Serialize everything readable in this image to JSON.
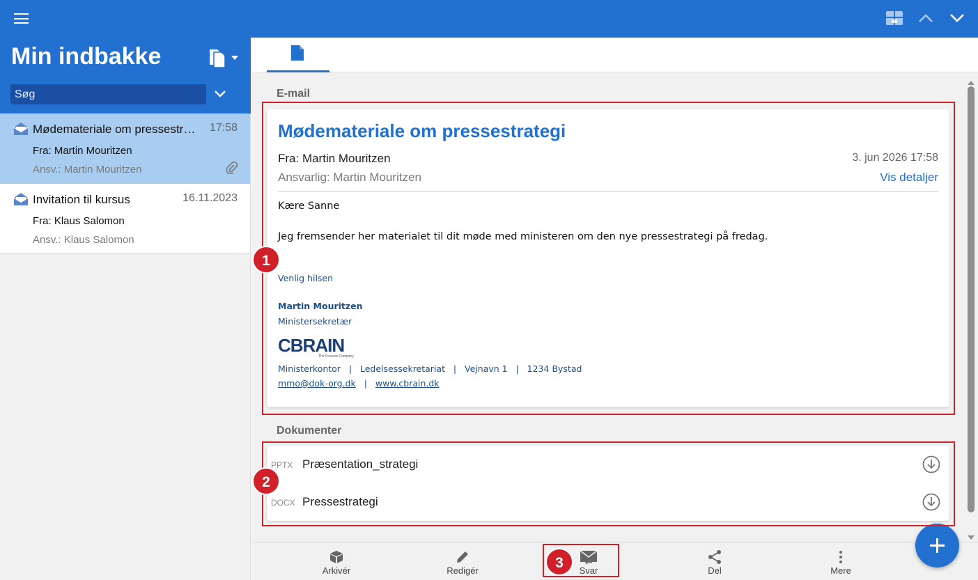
{
  "topbar": {
    "menu_icon": "hamburger-menu-icon",
    "right_icons": [
      "dossier-box-icon",
      "chevron-up-icon",
      "chevron-down-icon"
    ]
  },
  "inbox": {
    "title": "Min indbakke",
    "search_placeholder": "Søg",
    "items": [
      {
        "subject": "Mødemateriale om pressestr…",
        "time": "17:58",
        "from": "Fra: Martin Mouritzen",
        "responsible": "Ansv.: Martin Mouritzen",
        "has_attachment": true,
        "selected": true
      },
      {
        "subject": "Invitation til kursus",
        "time": "16.11.2023",
        "from": "Fra: Klaus Salomon",
        "responsible": "Ansv.: Klaus Salomon",
        "has_attachment": false,
        "selected": false
      }
    ]
  },
  "email": {
    "section_label": "E-mail",
    "subject": "Mødemateriale om pressestrategi",
    "from": "Fra: Martin Mouritzen",
    "date": "3. jun 2026 17:58",
    "responsible": "Ansvarlig: Martin Mouritzen",
    "details_link": "Vis detaljer",
    "greeting": "Kære Sanne",
    "body": "Jeg fremsender her materialet til dit møde med ministeren om den nye pressestrategi på fredag.",
    "signature": {
      "closing": "Venlig hilsen",
      "name": "Martin Mouritzen",
      "title": "Ministersekretær",
      "logo_text": "CBRAIN",
      "logo_tagline": "The Process Company",
      "address": "Ministerkontor   |   Ledelsessekretariat   |   Vejnavn 1   |   1234 Bystad",
      "email": "mmo@dok-org.dk",
      "separator": "|",
      "website": "www.cbrain.dk"
    }
  },
  "documents": {
    "section_label": "Dokumenter",
    "items": [
      {
        "type": "PPTX",
        "name": "Præsentation_strategi"
      },
      {
        "type": "DOCX",
        "name": "Pressestrategi"
      }
    ]
  },
  "toolbar": {
    "archive": "Arkivér",
    "edit": "Redigér",
    "reply": "Svar",
    "share": "Del",
    "more": "Mere"
  },
  "annotations": [
    "1",
    "2",
    "3"
  ],
  "colors": {
    "primary": "#2270cf",
    "selected_row": "#a9cdf0",
    "annotation": "#d0202a"
  }
}
